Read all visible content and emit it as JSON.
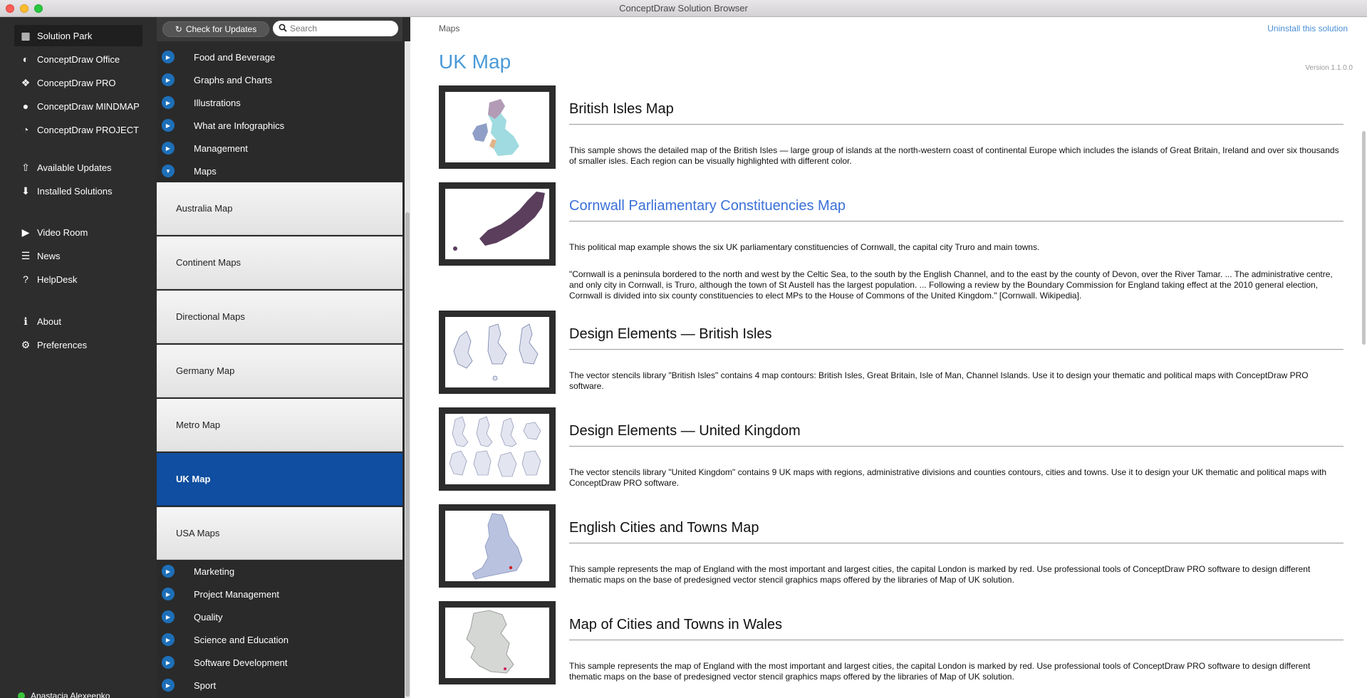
{
  "window": {
    "title": "ConceptDraw Solution Browser"
  },
  "leftnav": {
    "items": [
      {
        "label": "Solution Park",
        "icon": "grid-icon",
        "glyph": "▦"
      },
      {
        "label": "ConceptDraw Office",
        "icon": "office-icon",
        "glyph": "◐"
      },
      {
        "label": "ConceptDraw PRO",
        "icon": "pro-icon",
        "glyph": "❖"
      },
      {
        "label": "ConceptDraw MINDMAP",
        "icon": "bulb-icon",
        "glyph": "💡"
      },
      {
        "label": "ConceptDraw PROJECT",
        "icon": "pie-icon",
        "glyph": "◔"
      },
      {
        "label": "Available Updates",
        "icon": "updates-icon",
        "glyph": "⇧"
      },
      {
        "label": "Installed Solutions",
        "icon": "download-icon",
        "glyph": "⬇"
      },
      {
        "label": "Video Room",
        "icon": "play-icon",
        "glyph": "▶"
      },
      {
        "label": "News",
        "icon": "list-icon",
        "glyph": "☰"
      },
      {
        "label": "HelpDesk",
        "icon": "question-icon",
        "glyph": "?"
      },
      {
        "label": "About",
        "icon": "info-icon",
        "glyph": "ℹ"
      },
      {
        "label": "Preferences",
        "icon": "gear-icon",
        "glyph": "⚙"
      }
    ],
    "user": "Anastacia Alexeenko"
  },
  "toolbar": {
    "update_label": "Check for Updates",
    "search_placeholder": "Search"
  },
  "categories_top": [
    "Food and Beverage",
    "Graphs and Charts",
    "Illustrations",
    "What are Infographics",
    "Management",
    "Maps"
  ],
  "subitems": [
    "Australia Map",
    "Continent Maps",
    "Directional Maps",
    "Germany Map",
    "Metro Map",
    "UK Map",
    "USA Maps"
  ],
  "categories_bottom": [
    "Marketing",
    "Project Management",
    "Quality",
    "Science and Education",
    "Software Development",
    "Sport"
  ],
  "content": {
    "breadcrumb": "Maps",
    "uninstall": "Uninstall this solution",
    "title": "UK Map",
    "version": "Version 1.1.0.0",
    "items": [
      {
        "title": "British Isles Map",
        "desc": "This sample shows the detailed map of the British Isles — large group of islands at the north-western coast of continental Europe which includes the islands of Great Britain, Ireland and over six thousands of smaller isles. Each region can be visually highlighted with different color.",
        "desc2": ""
      },
      {
        "title": "Cornwall Parliamentary Constituencies Map",
        "desc": "This political map example shows the six UK parliamentary constituencies of Cornwall, the capital city Truro and main towns.",
        "desc2": "\"Cornwall is a peninsula bordered to the north and west by the Celtic Sea, to the south by the English Channel, and to the east by the county of Devon, over the River Tamar. ... The administrative centre, and only city in Cornwall, is Truro, although the town of St Austell has the largest population. ... Following a review by the Boundary Commission for England taking effect at the 2010 general election, Cornwall is divided into six county constituencies to elect MPs to the House of Commons of the United Kingdom.\" [Cornwall. Wikipedia]."
      },
      {
        "title": "Design Elements — British Isles",
        "desc": "The vector stencils library \"British Isles\" contains 4 map contours: British Isles, Great Britain, Isle of Man, Channel Islands. Use it to design your thematic and political maps with ConceptDraw PRO software.",
        "desc2": ""
      },
      {
        "title": "Design Elements — United Kingdom",
        "desc": "The vector stencils library \"United Kingdom\" contains 9 UK maps with regions, administrative divisions and counties contours, cities and towns. Use it to design your UK thematic and political maps with ConceptDraw PRO software.",
        "desc2": ""
      },
      {
        "title": "English Cities and Towns Map",
        "desc": "This sample represents the map of England with the most important and largest cities, the capital London is marked by red. Use professional tools of ConceptDraw PRO software to design different thematic maps on the base of predesigned vector stencil graphics maps offered by the libraries of Map of UK solution.",
        "desc2": ""
      },
      {
        "title": "Map of Cities and Towns in Wales",
        "desc": "This sample represents the map of England with the most important and largest cities, the capital London is marked by red. Use professional tools of ConceptDraw PRO software to design different thematic maps on the base of predesigned vector stencil graphics maps offered by the libraries of Map of UK solution.",
        "desc2": ""
      }
    ]
  },
  "colors": {
    "accent": "#0f4ea0",
    "bullet": "#1d6fb8",
    "link": "#3a70d8",
    "title": "#4a9ad8"
  }
}
